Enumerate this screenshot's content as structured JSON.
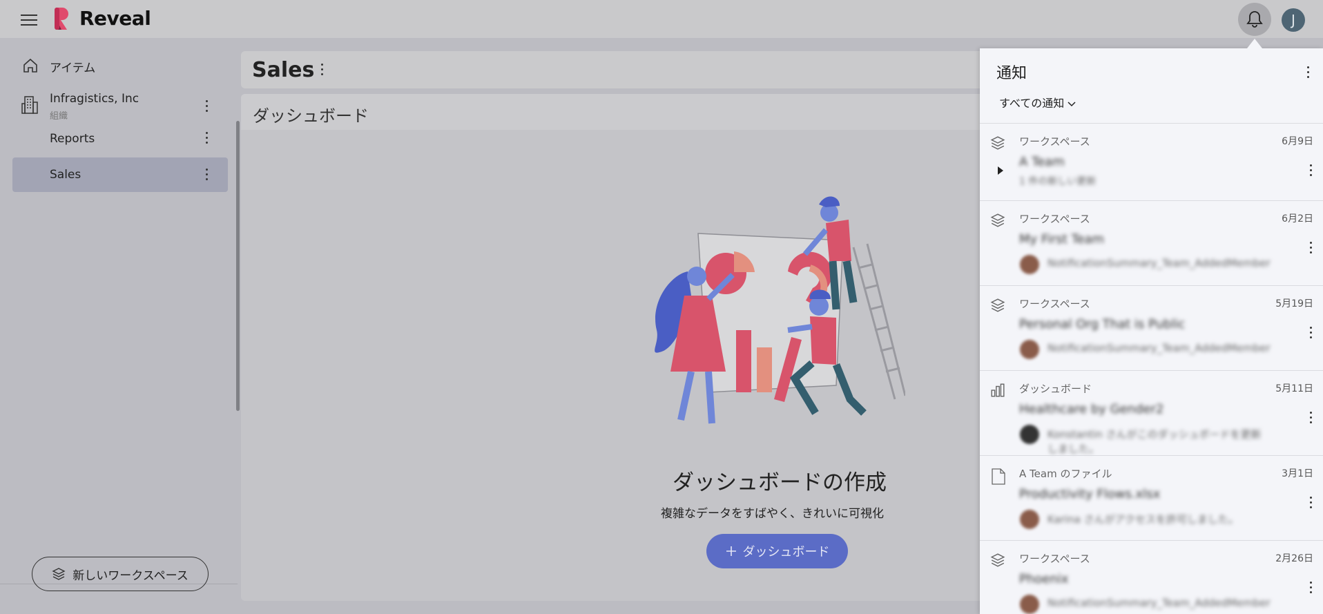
{
  "app": {
    "brand": "Reveal",
    "user_initial": "J"
  },
  "sidebar": {
    "items": [
      {
        "label": "アイテム",
        "icon": "home-icon"
      },
      {
        "label": "Infragistics, Inc",
        "sub": "組織",
        "icon": "building-icon"
      },
      {
        "label": "Reports"
      },
      {
        "label": "Sales",
        "active": true
      }
    ],
    "new_workspace_label": "新しいワークスペース"
  },
  "main": {
    "title": "Sales",
    "section_label": "ダッシュボード",
    "empty_title": "ダッシュボードの作成",
    "empty_subtitle": "複雑なデータをすばやく、きれいに可視化",
    "create_button_label": "ダッシュボード"
  },
  "notifications": {
    "title": "通知",
    "filter_label": "すべての通知",
    "items": [
      {
        "category": "ワークスペース",
        "date": "6月9日",
        "title": "A Team",
        "body": "1 件の新しい更新",
        "icon": "layers-icon",
        "expandable": true
      },
      {
        "category": "ワークスペース",
        "date": "6月2日",
        "title": "My First Team",
        "body": "NotificationSummary_Team_AddedMember",
        "icon": "layers-icon"
      },
      {
        "category": "ワークスペース",
        "date": "5月19日",
        "title": "Personal Org That is Public",
        "body": "NotificationSummary_Team_AddedMember",
        "icon": "layers-icon"
      },
      {
        "category": "ダッシュボード",
        "date": "5月11日",
        "title": "Healthcare by Gender2",
        "body": "Konstantin さんがこのダッシュボードを更新",
        "body2": "しました。",
        "icon": "bar-chart-icon",
        "dark_avatar": true
      },
      {
        "category": "A Team のファイル",
        "date": "3月1日",
        "title": "Productivity Flows.xlsx",
        "body": "Karina さんがアクセスを許可しました。",
        "icon": "file-icon"
      },
      {
        "category": "ワークスペース",
        "date": "2月26日",
        "title": "Phoenix",
        "body": "NotificationSummary_Team_AddedMember",
        "icon": "layers-icon"
      }
    ]
  },
  "colors": {
    "accent": "#5b6cc6",
    "active_item": "#a2a4b4",
    "avatar": "#4e6574"
  }
}
